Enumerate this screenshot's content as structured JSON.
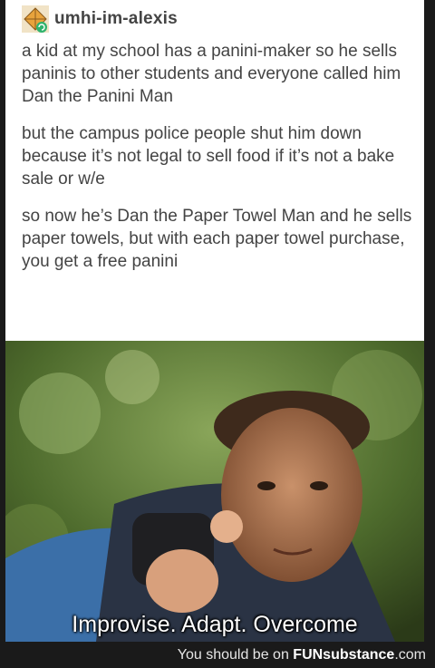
{
  "post": {
    "username": "umhi-im-alexis",
    "paragraphs": [
      "a kid at my school has a panini-maker so he sells paninis to other students and everyone called him Dan the Panini Man",
      "but the campus police people shut him down because it’s not legal to sell food if it’s not a bake sale or w/e",
      "so now he’s Dan the Paper Towel Man and he sells paper towels, but with each paper towel purchase, you get a free panini"
    ]
  },
  "meme": {
    "caption": "Improvise. Adapt. Overcome"
  },
  "footer": {
    "prefix": "You should be on ",
    "brand": "FUNsubstance",
    "suffix": ".com"
  },
  "colors": {
    "text": "#444444",
    "footer_bg": "#1a1a1a",
    "avatar_accent": "#e8a33c"
  }
}
